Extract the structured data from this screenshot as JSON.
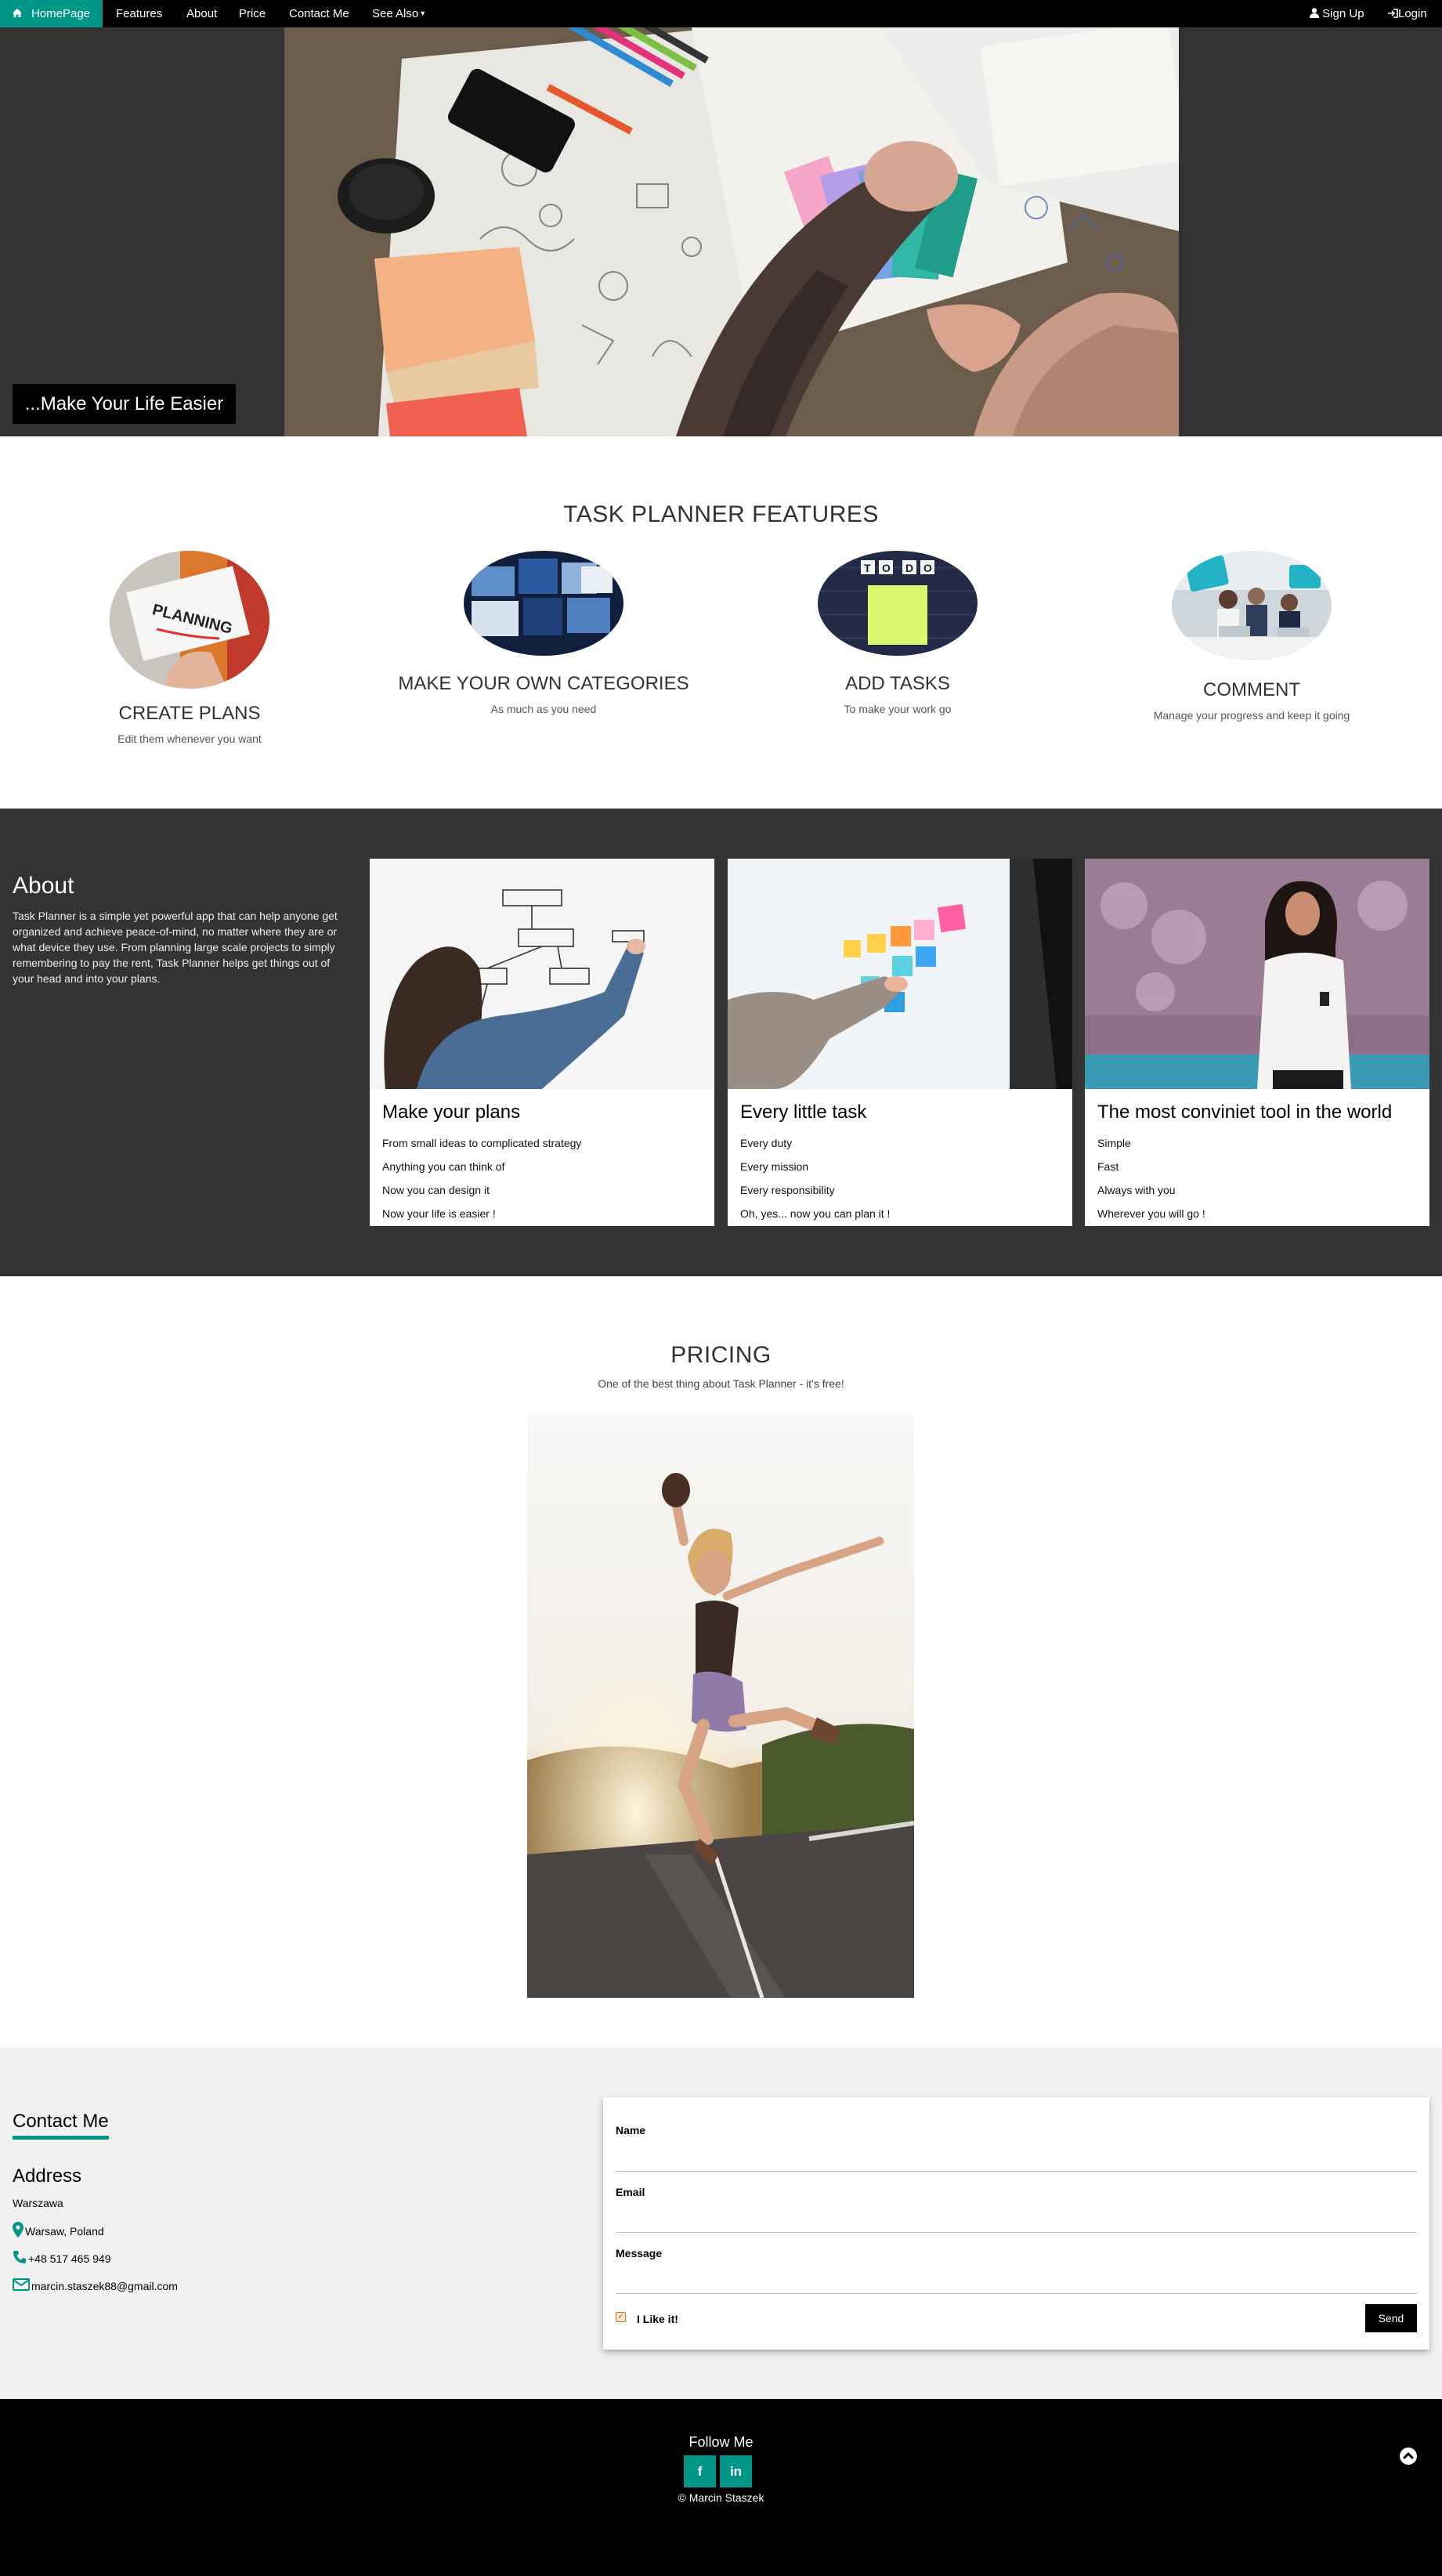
{
  "nav": {
    "home": "HomePage",
    "features": "Features",
    "about": "About",
    "price": "Price",
    "contact": "Contact Me",
    "see_also": "See Also",
    "sign_up": "Sign Up",
    "login": "Login"
  },
  "hero": {
    "caption": "...Make Your Life Easier"
  },
  "features": {
    "title": "TASK PLANNER FEATURES",
    "items": [
      {
        "title": "CREATE PLANS",
        "desc": "Edit them whenever you want"
      },
      {
        "title": "MAKE YOUR OWN CATEGORIES",
        "desc": "As much as you need"
      },
      {
        "title": "ADD TASKS",
        "desc": "To make your work go"
      },
      {
        "title": "COMMENT",
        "desc": "Manage your progress and keep it going"
      }
    ],
    "planning_word": "PLANNING",
    "todo_letters": [
      "T",
      "O",
      "D",
      "O"
    ]
  },
  "about": {
    "title": "About",
    "text": "Task Planner is a simple yet powerful app that can help anyone get organized and achieve peace-of-mind, no matter where they are or what device they use. From planning large scale projects to simply remembering to pay the rent, Task Planner helps get things out of your head and into your plans.",
    "cards": [
      {
        "title": "Make your plans",
        "lines": [
          "From small ideas to complicated strategy",
          "Anything you can think of",
          "Now you can design it",
          "Now your life is easier !"
        ]
      },
      {
        "title": "Every little task",
        "lines": [
          "Every duty",
          "Every mission",
          "Every responsibility",
          "Oh, yes... now you can plan it !"
        ]
      },
      {
        "title": "The most conviniet tool in the world",
        "lines": [
          "Simple",
          "Fast",
          "Always with you",
          "Wherever you will go !"
        ]
      }
    ]
  },
  "pricing": {
    "title": "PRICING",
    "subtitle": "One of the best thing about Task Planner - it's free!"
  },
  "contact": {
    "title": "Contact Me",
    "address_title": "Address",
    "city": "Warszawa",
    "location": "Warsaw, Poland",
    "phone": "+48 517 465 949",
    "email": "marcin.staszek88@gmail.com",
    "form": {
      "name_label": "Name",
      "email_label": "Email",
      "message_label": "Message",
      "like_label": "I Like it!",
      "like_checked": true,
      "send": "Send"
    }
  },
  "footer": {
    "follow": "Follow Me",
    "facebook": "f",
    "linkedin": "in",
    "copyright": "© Marcin Staszek"
  },
  "colors": {
    "accent": "#009688",
    "nav_bg": "#000000",
    "dark_section": "#333333",
    "contact_bg": "#f1f1f1"
  },
  "icons": [
    "home-icon",
    "user-icon",
    "login-icon",
    "caret-down-icon",
    "map-marker-icon",
    "phone-icon",
    "envelope-icon",
    "facebook-icon",
    "linkedin-icon",
    "chevron-up-icon"
  ]
}
